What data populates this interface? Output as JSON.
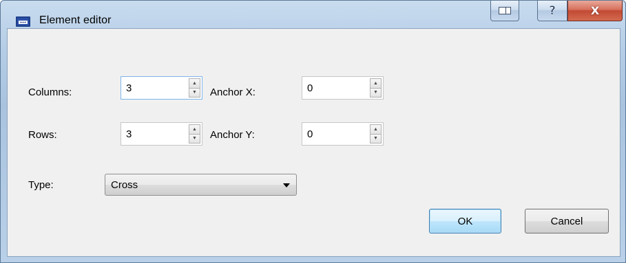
{
  "window": {
    "title": "Element editor",
    "caption_buttons": {
      "extra_icon": "window-switch-icon",
      "help_label": "?",
      "close_label": "X"
    }
  },
  "form": {
    "columns": {
      "label": "Columns:",
      "value": "3"
    },
    "rows": {
      "label": "Rows:",
      "value": "3"
    },
    "anchor_x": {
      "label": "Anchor X:",
      "value": "0"
    },
    "anchor_y": {
      "label": "Anchor Y:",
      "value": "0"
    },
    "type": {
      "label": "Type:",
      "selected": "Cross"
    }
  },
  "buttons": {
    "ok": "OK",
    "cancel": "Cancel"
  },
  "icons": {
    "spin_up": "▲",
    "spin_down": "▼"
  },
  "colors": {
    "title_bar": "#b5cde6",
    "client_background": "#f0f0f0",
    "close_button": "#c24a34",
    "focus_border": "#7eb4ea",
    "default_button": "#3c7fb1"
  }
}
